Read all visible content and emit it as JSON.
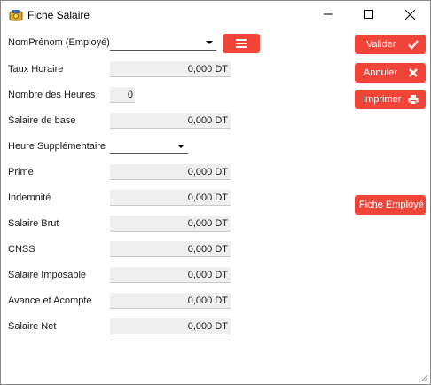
{
  "window": {
    "title": "Fiche Salaire"
  },
  "form": {
    "employee_label": "NomPrénom (Employé)",
    "employee_value": "",
    "taux_horaire": {
      "label": "Taux Horaire",
      "value": "0,000 DT"
    },
    "nombre_heures": {
      "label": "Nombre des Heures",
      "value": "0"
    },
    "salaire_base": {
      "label": "Salaire de base",
      "value": "0,000 DT"
    },
    "heure_supp": {
      "label": "Heure Supplémentaire",
      "value": ""
    },
    "prime": {
      "label": "Prime",
      "value": "0,000 DT"
    },
    "indemnite": {
      "label": "Indemnité",
      "value": "0,000 DT"
    },
    "salaire_brut": {
      "label": "Salaire Brut",
      "value": "0,000 DT"
    },
    "cnss": {
      "label": "CNSS",
      "value": "0,000 DT"
    },
    "salaire_imposable": {
      "label": "Salaire Imposable",
      "value": "0,000 DT"
    },
    "avance": {
      "label": "Avance et Acompte",
      "value": "0,000 DT"
    },
    "salaire_net": {
      "label": "Salaire Net",
      "value": "0,000 DT"
    }
  },
  "actions": {
    "valider": "Valider",
    "annuler": "Annuler",
    "imprimer": "Imprimer",
    "fiche_employe": "Fiche Employé"
  },
  "icons": {
    "app": "wallet-icon",
    "menu": "list-icon",
    "valider": "check-icon",
    "annuler": "close-icon",
    "imprimer": "printer-icon"
  },
  "colors": {
    "accent": "#f04438",
    "field_bg": "#efefef"
  }
}
